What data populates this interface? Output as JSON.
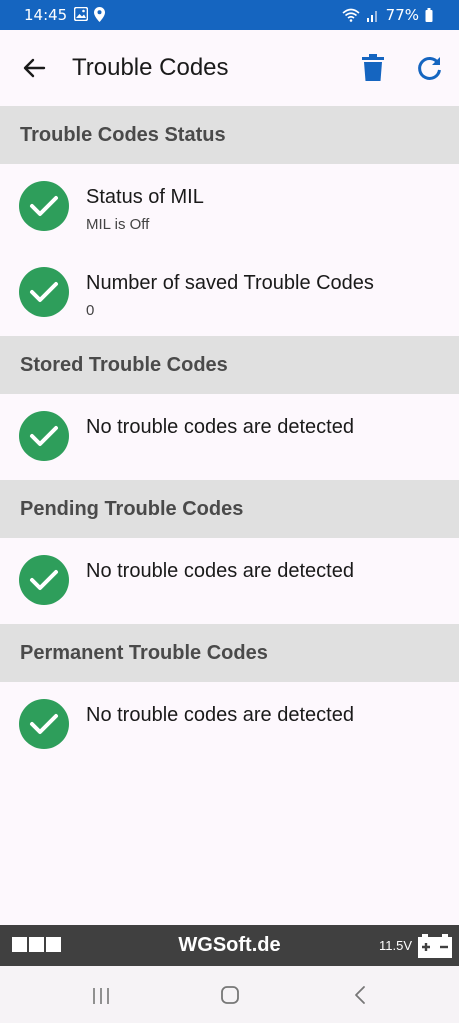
{
  "status_bar": {
    "time": "14:45",
    "battery": "77%",
    "left_icons": [
      "image-icon",
      "location-icon"
    ],
    "right_icons": [
      "wifi-icon",
      "signal-icon",
      "battery-icon"
    ]
  },
  "app_bar": {
    "title": "Trouble Codes",
    "icons": {
      "back": "back-arrow-icon",
      "delete": "trash-icon",
      "refresh": "refresh-icon"
    },
    "accent_color": "#1565c0"
  },
  "sections": {
    "status": {
      "header": "Trouble Codes Status",
      "items": [
        {
          "title": "Status of MIL",
          "subtitle": "MIL is Off"
        },
        {
          "title": "Number of saved Trouble Codes",
          "subtitle": "0"
        }
      ]
    },
    "stored": {
      "header": "Stored Trouble Codes",
      "message": "No trouble codes are detected"
    },
    "pending": {
      "header": "Pending Trouble Codes",
      "message": "No trouble codes are detected"
    },
    "permanent": {
      "header": "Permanent Trouble Codes",
      "message": "No trouble codes are detected"
    }
  },
  "status_color": "#2e9e5b",
  "footer": {
    "brand": "WGSoft.de",
    "voltage": "11.5V"
  },
  "nav": {
    "icons": [
      "recent-apps-icon",
      "home-icon",
      "back-icon"
    ]
  }
}
